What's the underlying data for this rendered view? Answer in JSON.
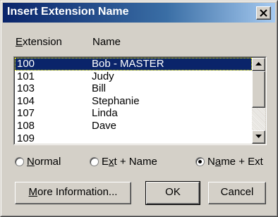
{
  "window": {
    "title": "Insert Extension Name"
  },
  "columns": {
    "extension": "Extension",
    "extension_hotkey": "E",
    "extension_rest": "xtension",
    "name": "Name"
  },
  "list": {
    "rows": [
      {
        "ext": "100",
        "name": "Bob - MASTER",
        "selected": true
      },
      {
        "ext": "101",
        "name": "Judy"
      },
      {
        "ext": "103",
        "name": "Bill"
      },
      {
        "ext": "104",
        "name": "Stephanie"
      },
      {
        "ext": "107",
        "name": "Linda"
      },
      {
        "ext": "108",
        "name": "Dave"
      },
      {
        "ext": "109",
        "name": ""
      }
    ]
  },
  "radios": {
    "normal": {
      "label": "Normal",
      "hotkey": "N",
      "rest": "ormal",
      "checked": false
    },
    "ext_name": {
      "label": "Ext + Name",
      "pre": "E",
      "hotkey": "x",
      "rest": "t + Name",
      "checked": false
    },
    "name_ext": {
      "label": "Name + Ext",
      "pre": "N",
      "hotkey": "a",
      "rest": "me + Ext",
      "checked": true
    }
  },
  "buttons": {
    "more_info": {
      "label": "More Information...",
      "hotkey": "M",
      "rest": "ore Information..."
    },
    "ok": {
      "label": "OK"
    },
    "cancel": {
      "label": "Cancel"
    }
  },
  "colors": {
    "selection": "#0a246a",
    "title_start": "#0a246a",
    "title_end": "#a6caf0",
    "face": "#d4d0c8"
  },
  "icons": {
    "close": "close-icon",
    "scroll_up": "arrow-up-icon",
    "scroll_down": "arrow-down-icon"
  }
}
